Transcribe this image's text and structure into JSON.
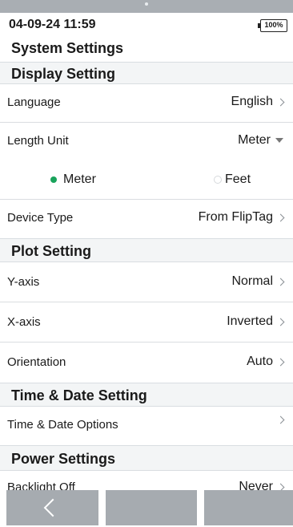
{
  "status_bar": {
    "datetime": "04-09-24 11:59",
    "battery": "100%"
  },
  "page": {
    "title": "System Settings"
  },
  "display_setting": {
    "title": "Display Setting",
    "language": {
      "label": "Language",
      "value": "English"
    },
    "length_unit": {
      "label": "Length Unit",
      "value": "Meter",
      "options": [
        {
          "label": "Meter",
          "selected": true
        },
        {
          "label": "Feet",
          "selected": false
        }
      ]
    },
    "device_type": {
      "label": "Device Type",
      "value": "From FlipTag"
    }
  },
  "plot_setting": {
    "title": "Plot Setting",
    "y_axis": {
      "label": "Y-axis",
      "value": "Normal"
    },
    "x_axis": {
      "label": "X-axis",
      "value": "Inverted"
    },
    "orientation": {
      "label": "Orientation",
      "value": "Auto"
    }
  },
  "time_date_setting": {
    "title": "Time & Date Setting",
    "options": {
      "label": "Time & Date Options"
    }
  },
  "power_settings": {
    "title": "Power Settings",
    "backlight_off": {
      "label": "Backlight Off",
      "value": "Never"
    }
  },
  "colors": {
    "accent": "#19a35b",
    "bar": "#a6abb0",
    "section_bg": "#f3f5f6"
  }
}
